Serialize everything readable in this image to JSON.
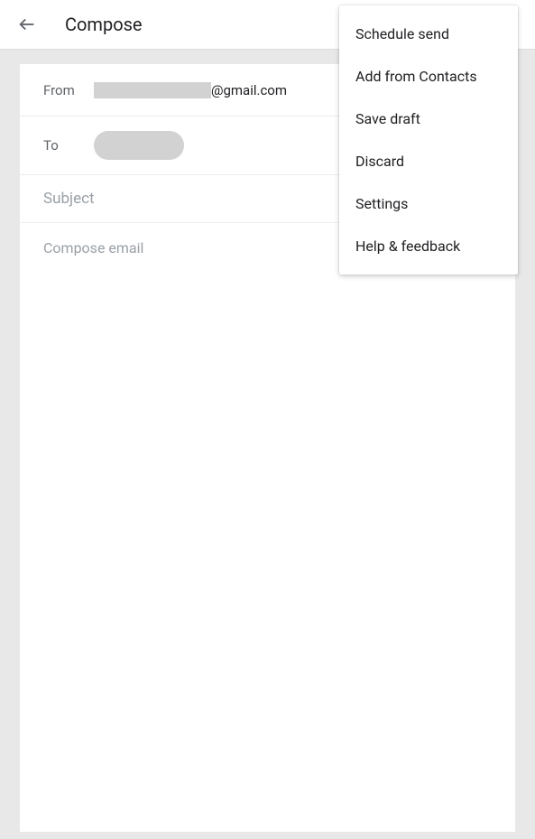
{
  "header": {
    "title": "Compose"
  },
  "fields": {
    "from_label": "From",
    "from_suffix": "@gmail.com",
    "to_label": "To",
    "subject_placeholder": "Subject",
    "body_placeholder": "Compose email"
  },
  "menu": {
    "schedule_send": "Schedule send",
    "add_from_contacts": "Add from Contacts",
    "save_draft": "Save draft",
    "discard": "Discard",
    "settings": "Settings",
    "help_feedback": "Help & feedback"
  }
}
